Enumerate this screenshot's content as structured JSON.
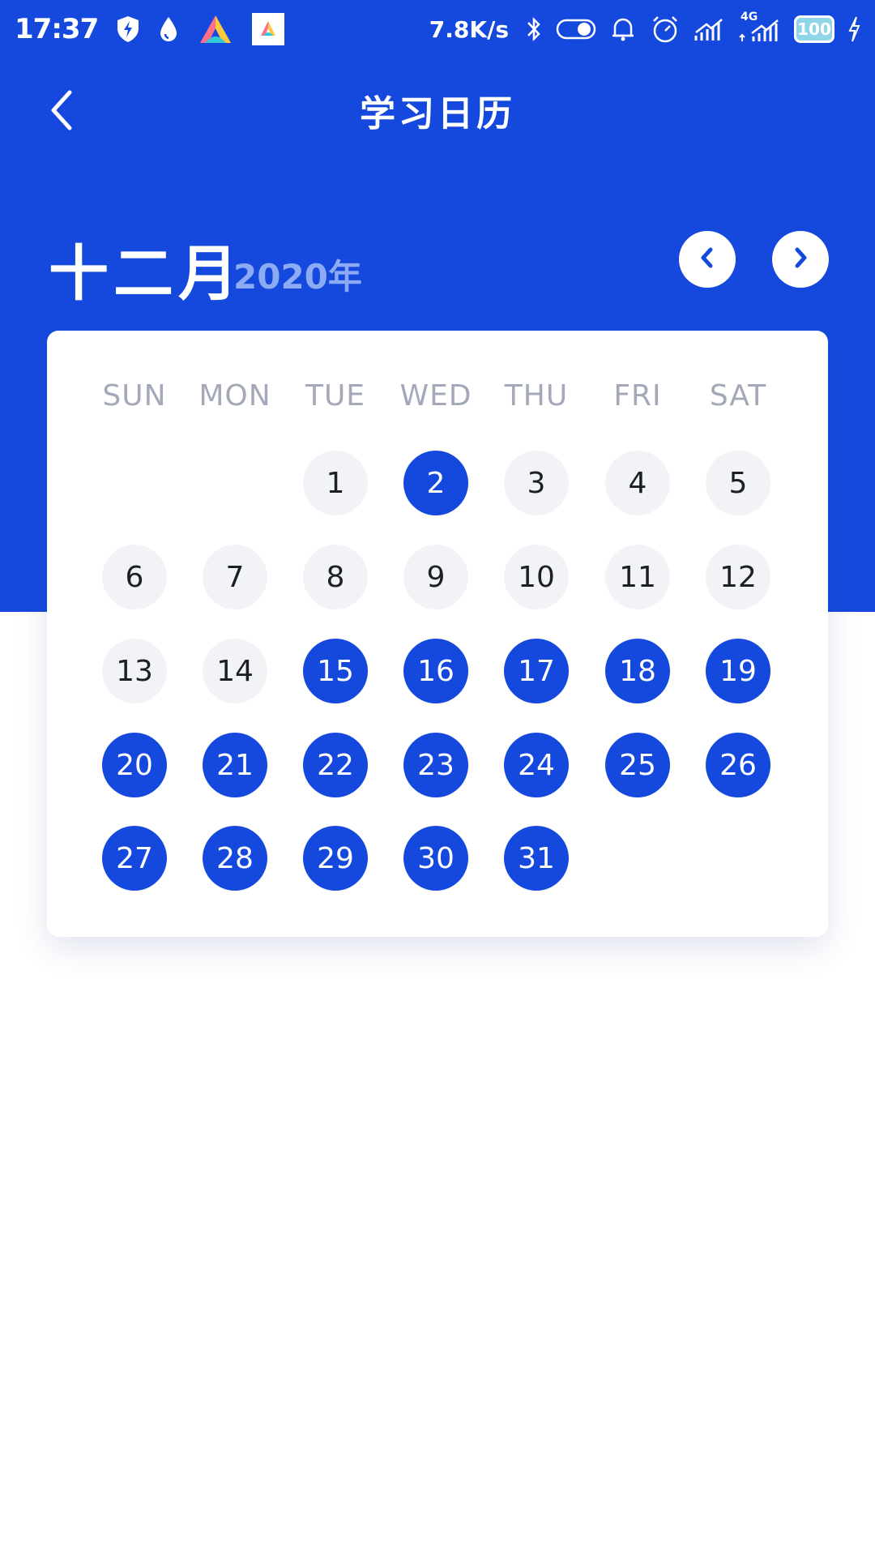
{
  "status_bar": {
    "time": "17:37",
    "net_speed": "7.8K/s",
    "network_type": "4G",
    "battery": "100",
    "icons": [
      "shield-bolt-icon",
      "water-drop-icon",
      "app-a-icon",
      "app-a-small-icon",
      "bluetooth-icon",
      "toggle-icon",
      "alarm-bell-icon",
      "alarm-clock-icon",
      "signal-icon",
      "signal-4g-icon",
      "battery-icon",
      "charging-icon"
    ]
  },
  "nav": {
    "title": "学习日历",
    "back_icon": "chevron-left-icon"
  },
  "calendar": {
    "month": "十二月",
    "year": "2020年",
    "prev_icon": "chevron-left-icon",
    "next_icon": "chevron-right-icon",
    "weekdays": [
      "SUN",
      "MON",
      "TUE",
      "WED",
      "THU",
      "FRI",
      "SAT"
    ],
    "first_weekday_index": 2,
    "days": [
      "1",
      "2",
      "3",
      "4",
      "5",
      "6",
      "7",
      "8",
      "9",
      "10",
      "11",
      "12",
      "13",
      "14",
      "15",
      "16",
      "17",
      "18",
      "19",
      "20",
      "21",
      "22",
      "23",
      "24",
      "25",
      "26",
      "27",
      "28",
      "29",
      "30",
      "31"
    ],
    "studied_days": [
      2,
      15,
      16,
      17,
      18,
      19,
      20,
      21,
      22,
      23,
      24,
      25,
      26,
      27,
      28,
      29,
      30,
      31
    ]
  },
  "colors": {
    "primary": "#1549dd",
    "day_inactive_bg": "#f1f3f7",
    "weekday_text": "#a3a9b8",
    "year_text": "#8cabf4"
  }
}
